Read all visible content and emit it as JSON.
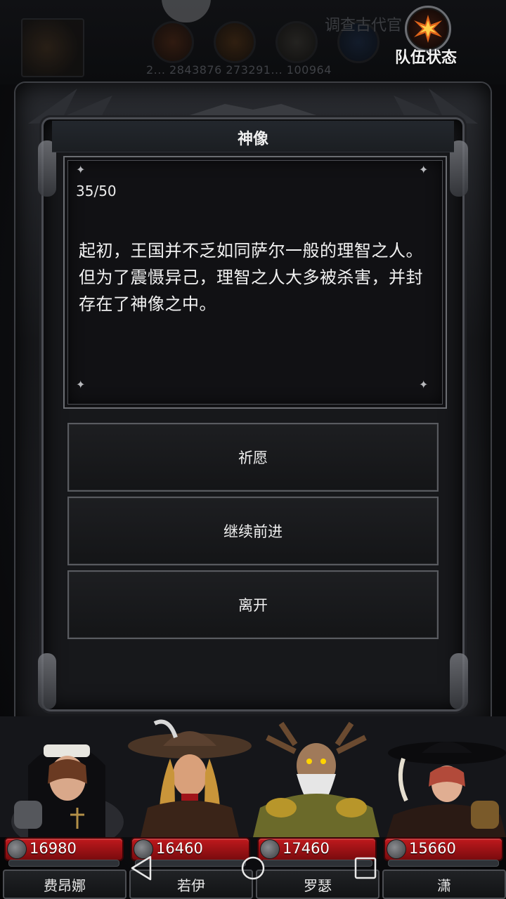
{
  "hud": {
    "quest_text": "调查古代官",
    "stats_text": "2... 2843876 273291... 100964",
    "team_status_label": "队伍状态"
  },
  "dialog": {
    "title": "神像",
    "progress": "35/50",
    "story": "起初，王国并不乏如同萨尔一般的理智之人。但为了震慑异己，理智之人大多被杀害，并封存在了神像之中。",
    "choices": [
      "祈愿",
      "继续前进",
      "离开"
    ]
  },
  "party": [
    {
      "name": "费昂娜",
      "hp": "16980",
      "mp_fraction": 0.0
    },
    {
      "name": "若伊",
      "hp": "16460",
      "mp_fraction": 0.0
    },
    {
      "name": "罗瑟",
      "hp": "17460",
      "mp_fraction": 0.0
    },
    {
      "name": "潇",
      "hp": "15660",
      "mp_fraction": 0.0
    }
  ],
  "nav": {
    "back": "back-icon",
    "home": "home-icon",
    "recents": "recents-icon"
  },
  "colors": {
    "hp_bar": "#c0191d",
    "panel_bg": "#111114",
    "frame": "#4a4c52"
  }
}
